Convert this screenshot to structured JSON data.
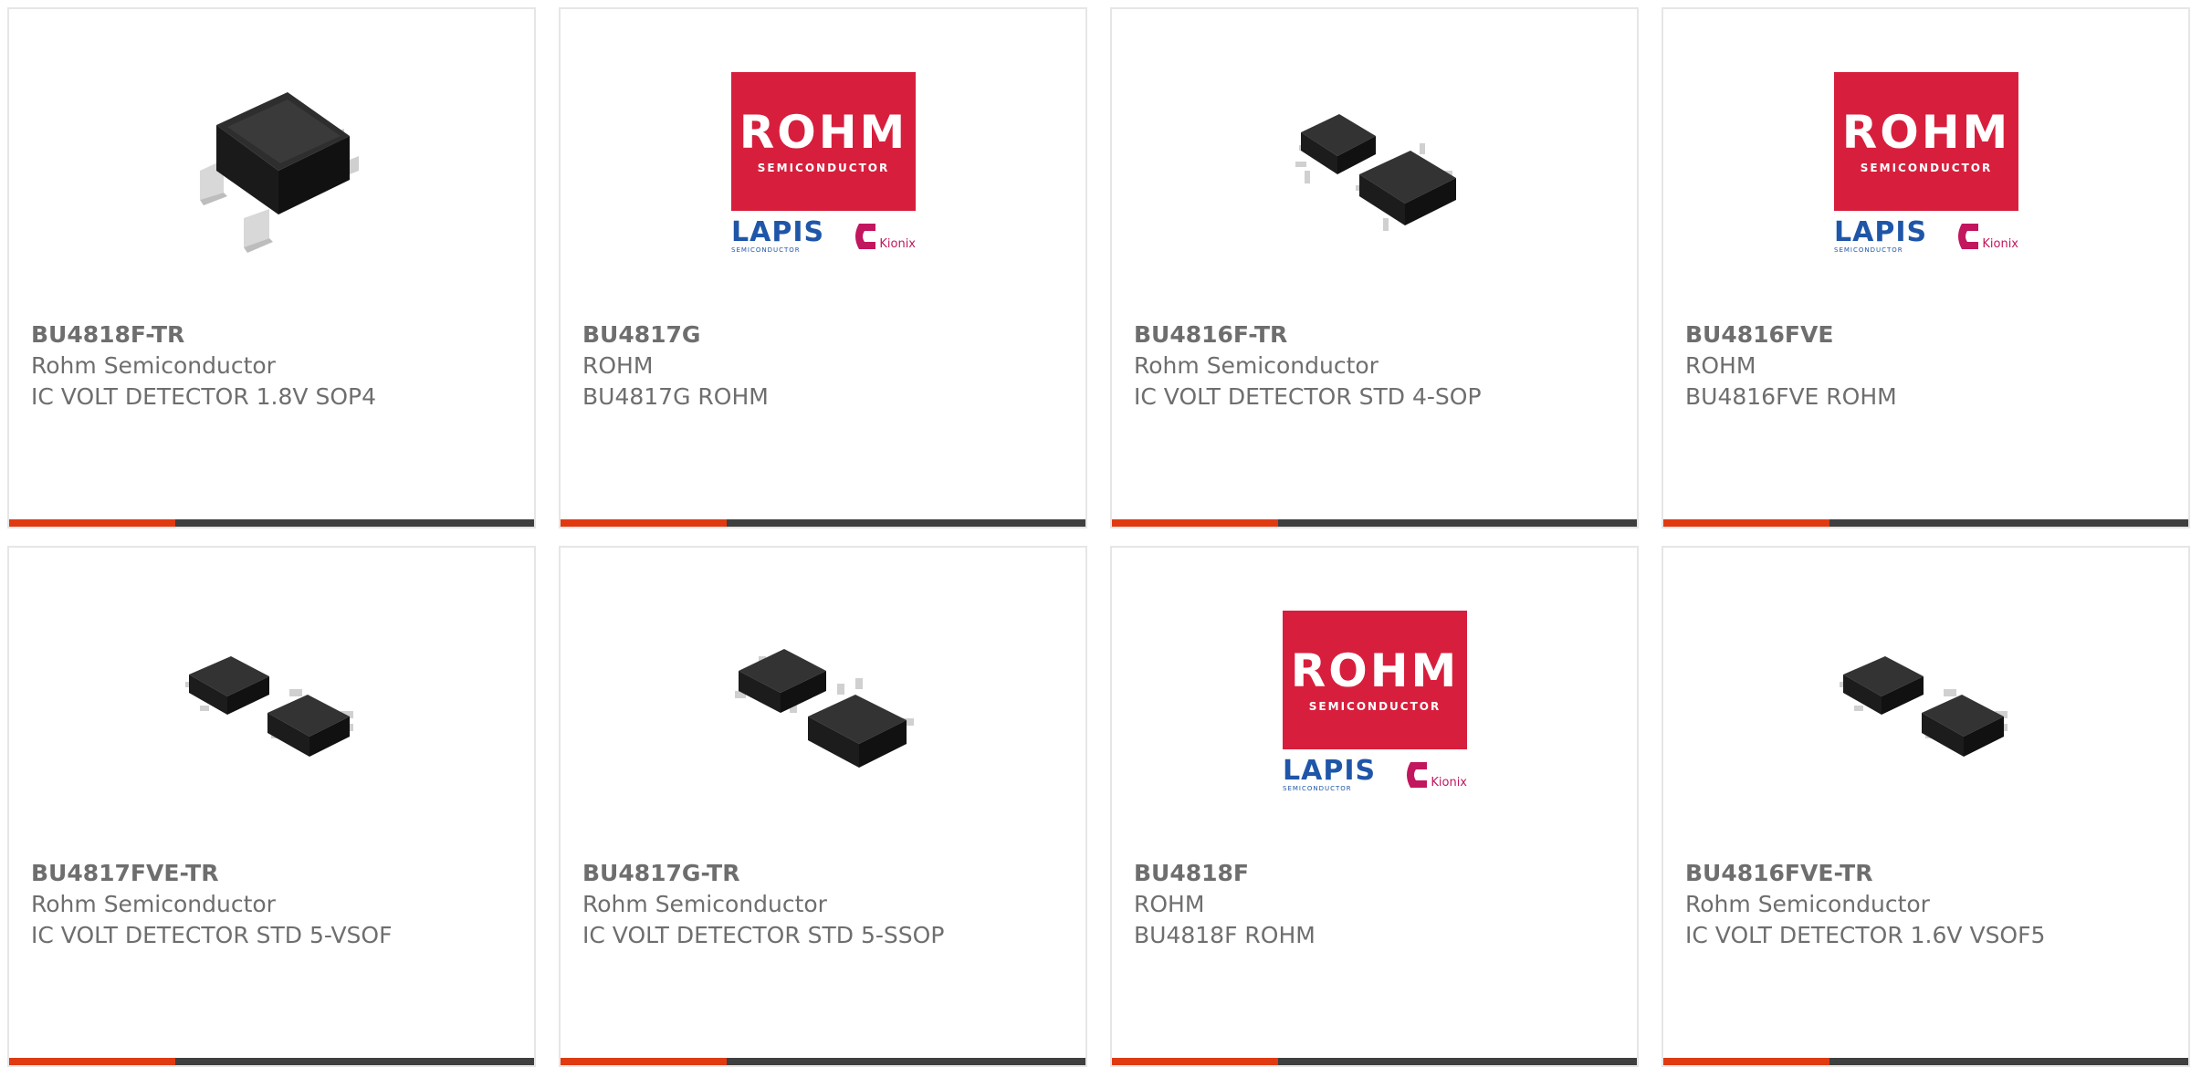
{
  "accent_color": "#e03a12",
  "bar_color": "#3f3f3f",
  "logo": {
    "brand": "ROHM",
    "brand_sub": "SEMICONDUCTOR",
    "lapis": "LAPIS",
    "lapis_sub": "SEMICONDUCTOR",
    "kionix": "Kionix"
  },
  "products": [
    {
      "part": "BU4818F-TR",
      "maker": "Rohm Semiconductor",
      "desc": "IC VOLT DETECTOR 1.8V SOP4",
      "image": "sop4-package-icon"
    },
    {
      "part": "BU4817G",
      "maker": "ROHM",
      "desc": "BU4817G ROHM",
      "image": "rohm-logo"
    },
    {
      "part": "BU4816F-TR",
      "maker": "Rohm Semiconductor",
      "desc": "IC VOLT DETECTOR STD 4-SOP",
      "image": "sop-pair-icon"
    },
    {
      "part": "BU4816FVE",
      "maker": "ROHM",
      "desc": "BU4816FVE ROHM",
      "image": "rohm-logo"
    },
    {
      "part": "BU4817FVE-TR",
      "maker": "Rohm Semiconductor",
      "desc": "IC VOLT DETECTOR STD 5-VSOF",
      "image": "vsof-pair-icon"
    },
    {
      "part": "BU4817G-TR",
      "maker": "Rohm Semiconductor",
      "desc": "IC VOLT DETECTOR STD 5-SSOP",
      "image": "ssop-pair-icon"
    },
    {
      "part": "BU4818F",
      "maker": "ROHM",
      "desc": "BU4818F ROHM",
      "image": "rohm-logo"
    },
    {
      "part": "BU4816FVE-TR",
      "maker": "Rohm Semiconductor",
      "desc": "IC VOLT DETECTOR 1.6V VSOF5",
      "image": "vsof-pair-icon"
    }
  ]
}
